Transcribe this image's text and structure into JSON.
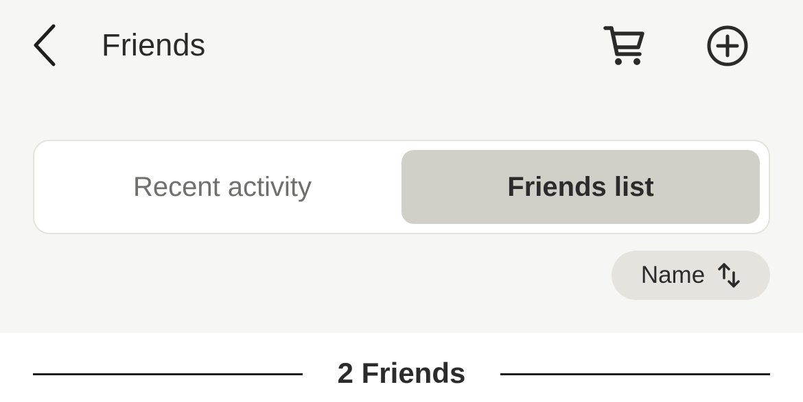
{
  "header": {
    "title": "Friends",
    "back_icon": "chevron-left-icon",
    "cart_icon": "shopping-cart-icon",
    "add_icon": "plus-circle-icon"
  },
  "tabs": [
    {
      "label": "Recent activity",
      "selected": false
    },
    {
      "label": "Friends list",
      "selected": true
    }
  ],
  "sort": {
    "label": "Name",
    "icon": "sort-arrows-icon"
  },
  "list": {
    "count_label": "2 Friends"
  },
  "colors": {
    "background": "#f6f6f5",
    "selected_tab": "#d0cfc8",
    "sort_pill": "#e4e3dd",
    "text": "#2b2b2b"
  }
}
